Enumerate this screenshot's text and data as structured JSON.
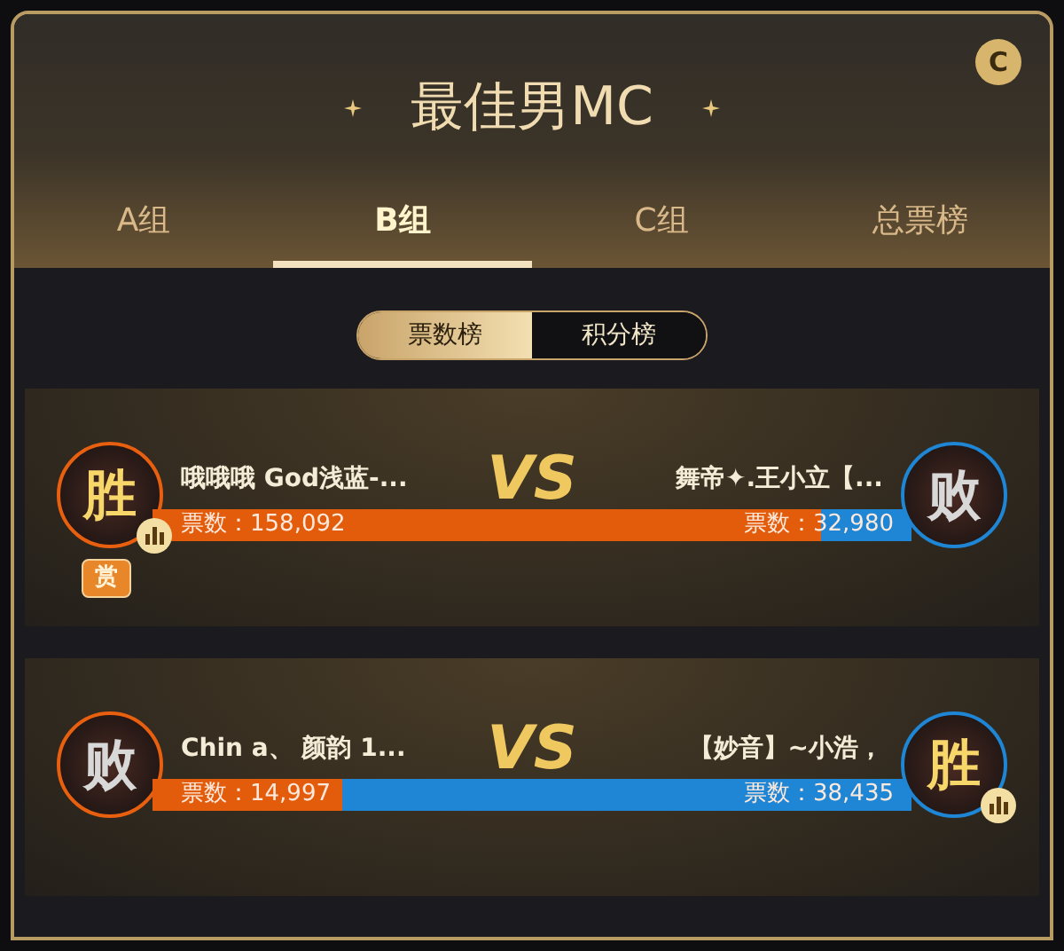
{
  "corner_button": "C",
  "title": "最佳男MC",
  "tabs": [
    {
      "label": "A组",
      "selected": false
    },
    {
      "label": "B组",
      "selected": true
    },
    {
      "label": "C组",
      "selected": false
    },
    {
      "label": "总票榜",
      "selected": false
    }
  ],
  "toggle": [
    {
      "label": "票数榜",
      "selected": true
    },
    {
      "label": "积分榜",
      "selected": false
    }
  ],
  "matches": [
    {
      "left": {
        "name": "哦哦哦 God浅蓝-...",
        "result": "胜",
        "winner": true,
        "votes": "票数：158,092"
      },
      "vs": "VS",
      "right": {
        "name": "舞帝✦.王小立【...",
        "result": "败",
        "winner": false,
        "votes": "票数：32,980"
      },
      "level": 0.88,
      "reward_badge": "赏"
    },
    {
      "left": {
        "name": "Chin a、 颜韵 1...",
        "result": "败",
        "winner": false,
        "votes": "票数：14,997"
      },
      "vs": "VS",
      "right": {
        "name": "【妙音】~小浩，",
        "result": "胜",
        "winner": true,
        "votes": "票数：38,435"
      },
      "level": 0.25
    }
  ]
}
